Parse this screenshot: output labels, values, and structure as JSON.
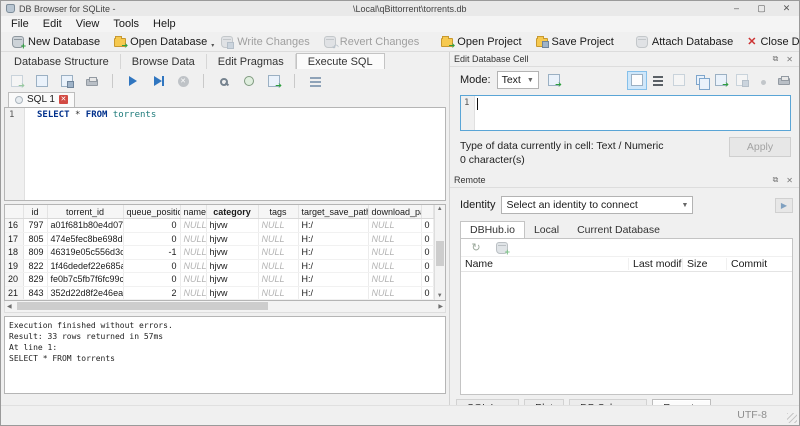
{
  "window": {
    "title": "DB Browser for SQLite -",
    "title_path": "\\Local\\qBittorrent\\torrents.db",
    "minimize": "–",
    "maximize": "▢",
    "close": "✕"
  },
  "menu": {
    "file": "File",
    "edit": "Edit",
    "view": "View",
    "tools": "Tools",
    "help": "Help"
  },
  "toolbar": {
    "new_db": "New Database",
    "open_db": "Open Database",
    "write_changes": "Write Changes",
    "revert_changes": "Revert Changes",
    "open_project": "Open Project",
    "save_project": "Save Project",
    "attach_db": "Attach Database",
    "close_db": "Close Database"
  },
  "tabs": {
    "t0": "Database Structure",
    "t1": "Browse Data",
    "t2": "Edit Pragmas",
    "t3": "Execute SQL",
    "active": "Execute SQL"
  },
  "sql": {
    "tab_label": "SQL 1",
    "line_number": "1",
    "kw_select": "SELECT",
    "star": "*",
    "kw_from": "FROM",
    "table_name": "torrents"
  },
  "results": {
    "headers": {
      "id": "id",
      "torrent_id": "torrent_id",
      "queue_position": "queue_position",
      "name": "name",
      "category": "category",
      "tags": "tags",
      "target_save_path": "target_save_path",
      "download_path": "download_path"
    },
    "rows": [
      {
        "n": "16",
        "id": "797",
        "tid": "a01f681b80e4d07285...",
        "qp": "0",
        "name": "NULL",
        "cat": "hjvw",
        "tags": "NULL",
        "tsp": "H:/",
        "dp": "NULL",
        "x": "0"
      },
      {
        "n": "17",
        "id": "805",
        "tid": "474e5fec8be698ddd7...",
        "qp": "0",
        "name": "NULL",
        "cat": "hjvw",
        "tags": "NULL",
        "tsp": "H:/",
        "dp": "NULL",
        "x": "0"
      },
      {
        "n": "18",
        "id": "809",
        "tid": "46319e05c556d3c494...",
        "qp": "-1",
        "name": "NULL",
        "cat": "hjvw",
        "tags": "NULL",
        "tsp": "H:/",
        "dp": "NULL",
        "x": "0"
      },
      {
        "n": "19",
        "id": "822",
        "tid": "1f46dedef22e685a63a...",
        "qp": "0",
        "name": "NULL",
        "cat": "hjvw",
        "tags": "NULL",
        "tsp": "H:/",
        "dp": "NULL",
        "x": "0"
      },
      {
        "n": "20",
        "id": "829",
        "tid": "fe0b7c5fb7f6fc99cbed...",
        "qp": "0",
        "name": "NULL",
        "cat": "hjvw",
        "tags": "NULL",
        "tsp": "H:/",
        "dp": "NULL",
        "x": "0"
      },
      {
        "n": "21",
        "id": "843",
        "tid": "352d22d8f2e46ea249...",
        "qp": "2",
        "name": "NULL",
        "cat": "hjvw",
        "tags": "NULL",
        "tsp": "H:/",
        "dp": "NULL",
        "x": "0"
      }
    ]
  },
  "log": {
    "line1": "Execution finished without errors.",
    "line2": "Result: 33 rows returned in 57ms",
    "line3": "At line 1:",
    "line4": "SELECT * FROM torrents"
  },
  "edit_cell": {
    "title": "Edit Database Cell",
    "mode_label": "Mode:",
    "mode_value": "Text",
    "line_number": "1",
    "type_info": "Type of data currently in cell: Text / Numeric",
    "char_count": "0 character(s)",
    "apply_label": "Apply"
  },
  "remote": {
    "title": "Remote",
    "identity_label": "Identity",
    "identity_value": "Select an identity to connect",
    "tab_dbhub": "DBHub.io",
    "tab_local": "Local",
    "tab_current": "Current Database",
    "active_tab": "DBHub.io",
    "col_name": "Name",
    "col_modified": "Last modified",
    "col_size": "Size",
    "col_commit": "Commit"
  },
  "bottom_tabs": {
    "b0": "SQL Log",
    "b1": "Plot",
    "b2": "DB Schema",
    "b3": "Remote",
    "active": "Remote"
  },
  "status": {
    "encoding": "UTF-8"
  },
  "colors": {
    "accent_green": "#2f9e3f",
    "danger_red": "#cd3434",
    "keyword_blue": "#00308c",
    "table_teal": "#1d7a7a",
    "null_grey": "#b3b3b3",
    "selection_blue": "#cfe7fa"
  }
}
